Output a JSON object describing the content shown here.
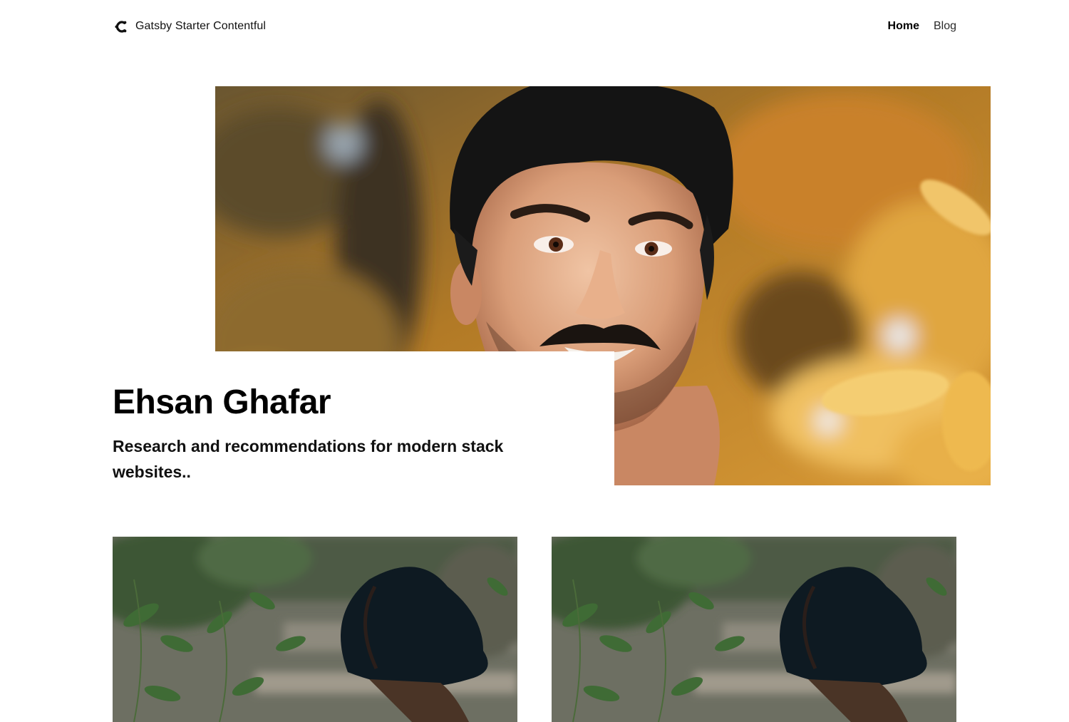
{
  "header": {
    "brand_name": "Gatsby Starter Contentful",
    "logo_icon": "contentful-logo-icon",
    "nav": [
      {
        "label": "Home",
        "active": true
      },
      {
        "label": "Blog",
        "active": false
      }
    ]
  },
  "hero": {
    "name": "Ehsan Ghafar",
    "subtitle": "Research and recommendations for modern stack websites..",
    "image_subject": "portrait of smiling man with mustache in front of autumn foliage"
  },
  "previews": [
    {
      "image_subject": "person in black wide-brim hat among green leaves"
    },
    {
      "image_subject": "person in black wide-brim hat among green leaves"
    }
  ],
  "colors": {
    "text": "#111111",
    "background": "#ffffff",
    "autumn_orange": "#c98a2b",
    "foliage_green": "#3f5a38",
    "hat_black": "#0e1a22"
  }
}
